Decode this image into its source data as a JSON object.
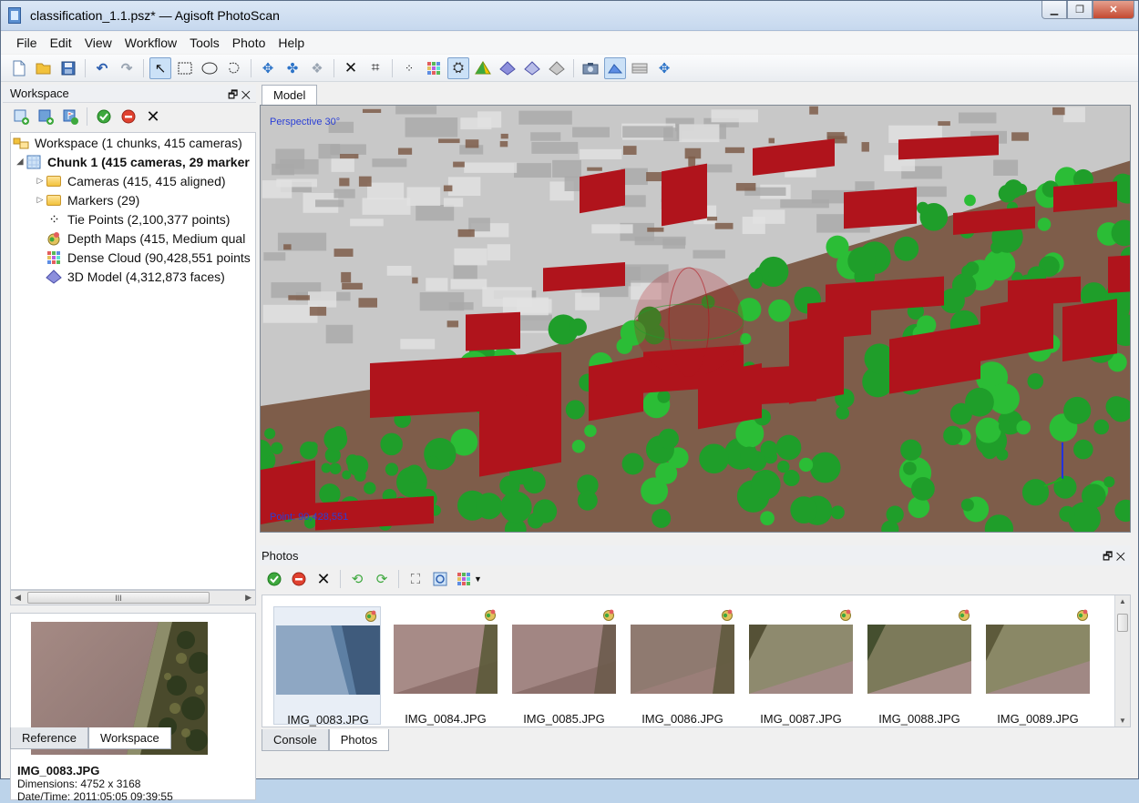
{
  "window": {
    "title": "classification_1.1.psz* — Agisoft PhotoScan",
    "buttons": {
      "minimize": "▁",
      "maximize": "❐",
      "close": "✕"
    }
  },
  "menu": [
    "File",
    "Edit",
    "View",
    "Workflow",
    "Tools",
    "Photo",
    "Help"
  ],
  "toolbar": {
    "icons": [
      "new-file-icon",
      "open-folder-icon",
      "save-icon",
      "undo-icon",
      "redo-icon",
      "select-pointer-icon",
      "rect-select-icon",
      "ellipse-select-icon",
      "free-select-icon",
      "rotate-object-icon",
      "move-object-icon",
      "scale-object-icon",
      "delete-icon",
      "crop-icon",
      "tie-points-icon",
      "dense-cloud-icon",
      "shaded-model-icon",
      "solid-model-icon",
      "wireframe-model-icon",
      "textured-model-icon",
      "model-icon",
      "camera-icon",
      "show-cameras-icon",
      "show-region-icon",
      "navigate-icon"
    ],
    "accent": "#7da2ce"
  },
  "workspace": {
    "panel_title": "Workspace",
    "tree": [
      {
        "label": "Workspace (1 chunks, 415 cameras)",
        "icon": "workspace-icon",
        "level": 0,
        "bold": false
      },
      {
        "label": "Chunk 1 (415 cameras, 29 marker",
        "icon": "chunk-icon",
        "level": 1,
        "bold": true,
        "expanded": true
      },
      {
        "label": "Cameras (415, 415 aligned)",
        "icon": "folder-icon",
        "level": 2,
        "bold": false,
        "expandable": true
      },
      {
        "label": "Markers (29)",
        "icon": "folder-icon",
        "level": 2,
        "bold": false,
        "expandable": true
      },
      {
        "label": "Tie Points (2,100,377 points)",
        "icon": "tie-points-icon",
        "level": 2,
        "bold": false
      },
      {
        "label": "Depth Maps (415, Medium qual",
        "icon": "depth-maps-icon",
        "level": 2,
        "bold": false
      },
      {
        "label": "Dense Cloud (90,428,551 points",
        "icon": "dense-cloud-icon",
        "level": 2,
        "bold": false
      },
      {
        "label": "3D Model (4,312,873 faces)",
        "icon": "model-3d-icon",
        "level": 2,
        "bold": false
      }
    ],
    "scroll_glyph": "III"
  },
  "preview": {
    "name": "IMG_0083.JPG",
    "dimensions": "Dimensions: 4752 x 3168",
    "datetime": "Date/Time: 2011:05:05 09:39:55"
  },
  "left_tabs": [
    "Reference",
    "Workspace"
  ],
  "model": {
    "tab": "Model",
    "perspective": "Perspective 30°",
    "points": "Point: 90,428,551",
    "colors": {
      "ground": "#7e5d4a",
      "building": "#b0141c",
      "vegetation": "#1f9e2a",
      "unclassified": "#c8c8c8"
    }
  },
  "photos": {
    "panel_title": "Photos",
    "items": [
      "IMG_0083.JPG",
      "IMG_0084.JPG",
      "IMG_0085.JPG",
      "IMG_0086.JPG",
      "IMG_0087.JPG",
      "IMG_0088.JPG",
      "IMG_0089.JPG"
    ],
    "selected": "IMG_0083.JPG"
  },
  "right_tabs": [
    "Console",
    "Photos"
  ]
}
